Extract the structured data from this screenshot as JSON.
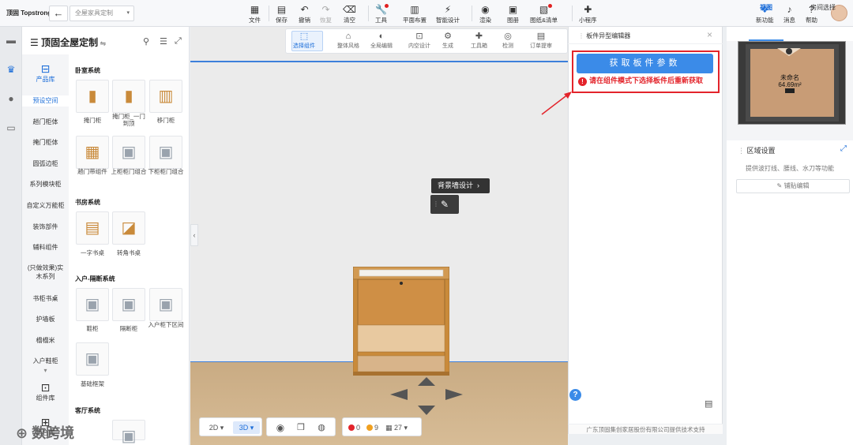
{
  "topbar": {
    "logo": "顶固 Topstrong",
    "back_icon": "arrow-left-icon",
    "project_select": "全屋家具定制",
    "tools": [
      {
        "label": "文件",
        "icon": "file-icon"
      },
      {
        "label": "保存",
        "icon": "save-icon"
      },
      {
        "label": "撤销",
        "icon": "undo-icon"
      },
      {
        "label": "恢复",
        "icon": "redo-icon"
      },
      {
        "label": "清空",
        "icon": "eraser-icon"
      },
      {
        "label": "工具",
        "icon": "wrench-icon"
      },
      {
        "label": "平面布置",
        "icon": "layout-icon"
      },
      {
        "label": "智能设计",
        "icon": "lightning-icon"
      },
      {
        "label": "渲染",
        "icon": "camera-icon"
      },
      {
        "label": "图册",
        "icon": "album-icon"
      },
      {
        "label": "图纸&清单",
        "icon": "drawing-list-icon"
      },
      {
        "label": "小程序",
        "icon": "puzzle-icon"
      }
    ],
    "right": [
      {
        "label": "新功能",
        "icon": "new-feature-icon"
      },
      {
        "label": "消息",
        "icon": "bell-icon"
      },
      {
        "label": "帮助",
        "icon": "help-icon"
      }
    ]
  },
  "left_panel": {
    "title": "顶固全屋定制",
    "library_tabs": [
      {
        "label": "产品库",
        "icon": "product-library-icon"
      },
      {
        "label": "组件库",
        "icon": "component-library-icon"
      },
      {
        "label": "组合库",
        "icon": "combo-library-icon"
      }
    ],
    "categories": [
      "预设空间",
      "趟门柜体",
      "掩门柜体",
      "圆弧边柜",
      "系列模块柜",
      "自定义万能柜",
      "装饰部件",
      "辅料组件",
      "(只做效果)实木系列",
      "书柜书桌",
      "护墙板",
      "榻榻米",
      "入户鞋柜"
    ],
    "sections": [
      {
        "title": "卧室系统",
        "items": [
          "掩门柜",
          "掩门柜_一门到顶",
          "移门柜",
          "趟门带组件",
          "上柜柜门组合",
          "下柜柜门组合"
        ]
      },
      {
        "title": "书房系统",
        "items": [
          "一字书桌",
          "转角书桌"
        ]
      },
      {
        "title": "入户-隔断系统",
        "items": [
          "鞋柜",
          "隔断柜",
          "入户柜下区间",
          "基础框架"
        ]
      },
      {
        "title": "客厅系统",
        "items": []
      }
    ]
  },
  "canvas_toolbar": [
    {
      "label": "选择组件",
      "icon": "select-component-icon"
    },
    {
      "label": "整体风格",
      "icon": "style-brush-icon"
    },
    {
      "label": "全局编辑",
      "icon": "palette-icon"
    },
    {
      "label": "内空设计",
      "icon": "inner-space-icon"
    },
    {
      "label": "生成",
      "icon": "generate-icon"
    },
    {
      "label": "工具箱",
      "icon": "toolbox-icon"
    },
    {
      "label": "检测",
      "icon": "detect-icon"
    },
    {
      "label": "订单提审",
      "icon": "order-submit-icon"
    }
  ],
  "canvas": {
    "wall_design_button": "背景墙设计",
    "edit_icon": "pencil-icon",
    "view_2d": "2D",
    "view_3d": "3D",
    "status_errors": "0",
    "status_warnings": "9",
    "status_count": "27"
  },
  "watermark": "数跨境",
  "editor": {
    "title": "板件异型编辑器",
    "get_params_button": "获取板件参数",
    "error_message": "请在组件模式下选择板件后重新获取",
    "footer": "广东顶固集创家居股份有限公司提供技术支持"
  },
  "right_panel": {
    "tabs": [
      "视图",
      "房间选择"
    ],
    "room_name": "未命名",
    "room_area": "64.69m²",
    "zone_title": "区域设置",
    "zone_desc": "提供波打线、腰线、水刀等功能",
    "paste_edit_button": "铺贴编辑"
  },
  "colors": {
    "accent": "#3b8be8",
    "error": "#e3242b",
    "wood": "#c98a3a"
  }
}
